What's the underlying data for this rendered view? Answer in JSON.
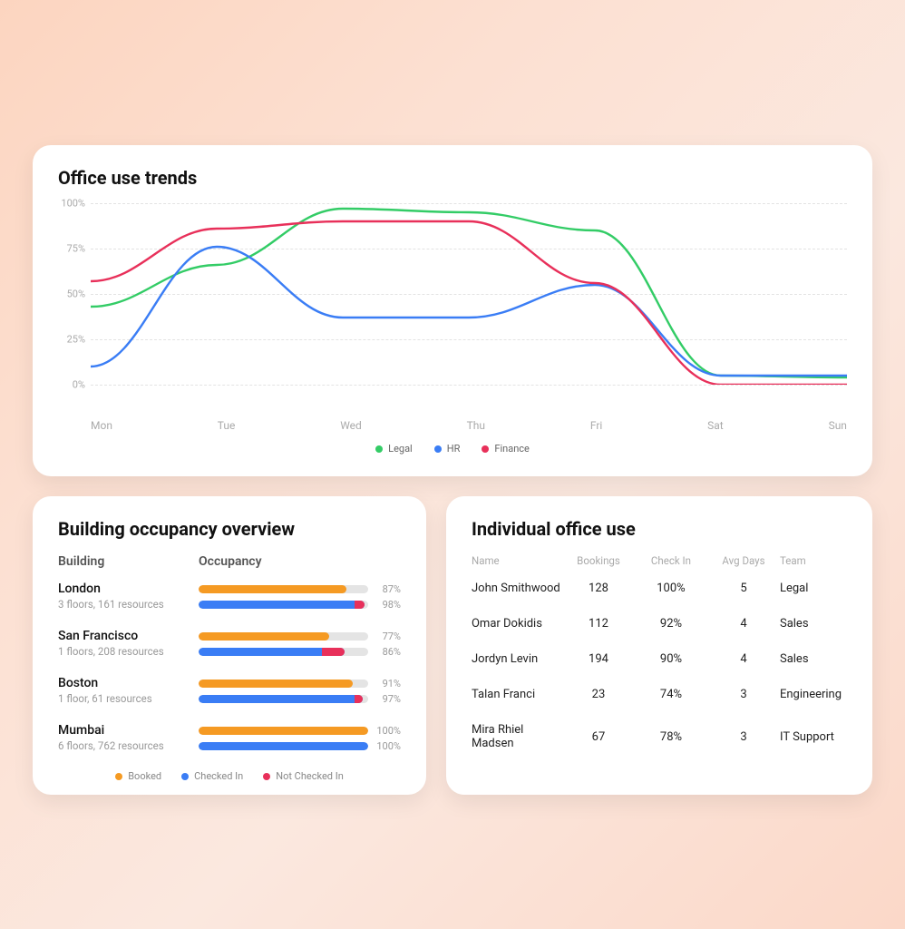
{
  "colors": {
    "legal": "#33cc66",
    "hr": "#3a7df5",
    "finance": "#e8305a",
    "booked": "#f59a23",
    "checked_in": "#3a7df5",
    "not_checked_in": "#e8305a",
    "track": "#e4e4e4"
  },
  "trends": {
    "title": "Office use trends",
    "legend": {
      "legal": "Legal",
      "hr": "HR",
      "finance": "Finance"
    }
  },
  "chart_data": {
    "type": "line",
    "title": "Office use trends",
    "xlabel": "",
    "ylabel": "",
    "ylim": [
      0,
      100
    ],
    "y_ticks": [
      "0%",
      "25%",
      "50%",
      "75%",
      "100%"
    ],
    "categories": [
      "Mon",
      "Tue",
      "Wed",
      "Thu",
      "Fri",
      "Sat",
      "Sun"
    ],
    "series": [
      {
        "name": "Legal",
        "color": "#33cc66",
        "values": [
          43,
          66,
          97,
          95,
          85,
          5,
          4
        ]
      },
      {
        "name": "HR",
        "color": "#3a7df5",
        "values": [
          10,
          76,
          37,
          37,
          55,
          5,
          5
        ]
      },
      {
        "name": "Finance",
        "color": "#e8305a",
        "values": [
          57,
          86,
          90,
          90,
          56,
          0,
          0
        ]
      }
    ]
  },
  "occupancy": {
    "title": "Building occupancy overview",
    "columns": {
      "building": "Building",
      "occupancy": "Occupancy"
    },
    "legend": {
      "booked": "Booked",
      "checked_in": "Checked In",
      "not_checked_in": "Not Checked In"
    },
    "rows": [
      {
        "name": "London",
        "sub": "3 floors, 161 resources",
        "booked_pct": 87,
        "checkin_pct": 98,
        "not_checked_pct": 6
      },
      {
        "name": "San Francisco",
        "sub": "1 floors, 208 resources",
        "booked_pct": 77,
        "checkin_pct": 86,
        "not_checked_pct": 13
      },
      {
        "name": "Boston",
        "sub": "1 floor, 61 resources",
        "booked_pct": 91,
        "checkin_pct": 97,
        "not_checked_pct": 5
      },
      {
        "name": "Mumbai",
        "sub": "6 floors, 762 resources",
        "booked_pct": 100,
        "checkin_pct": 100,
        "not_checked_pct": 0
      }
    ]
  },
  "individual": {
    "title": "Individual office use",
    "columns": {
      "name": "Name",
      "bookings": "Bookings",
      "checkin": "Check In",
      "avgdays": "Avg Days",
      "team": "Team"
    },
    "rows": [
      {
        "name": "John Smithwood",
        "bookings": "128",
        "checkin": "100%",
        "avgdays": "5",
        "team": "Legal"
      },
      {
        "name": "Omar Dokidis",
        "bookings": "112",
        "checkin": "92%",
        "avgdays": "4",
        "team": "Sales"
      },
      {
        "name": "Jordyn Levin",
        "bookings": "194",
        "checkin": "90%",
        "avgdays": "4",
        "team": "Sales"
      },
      {
        "name": "Talan Franci",
        "bookings": "23",
        "checkin": "74%",
        "avgdays": "3",
        "team": "Engineering"
      },
      {
        "name": "Mira Rhiel Madsen",
        "bookings": "67",
        "checkin": "78%",
        "avgdays": "3",
        "team": "IT Support"
      }
    ]
  }
}
